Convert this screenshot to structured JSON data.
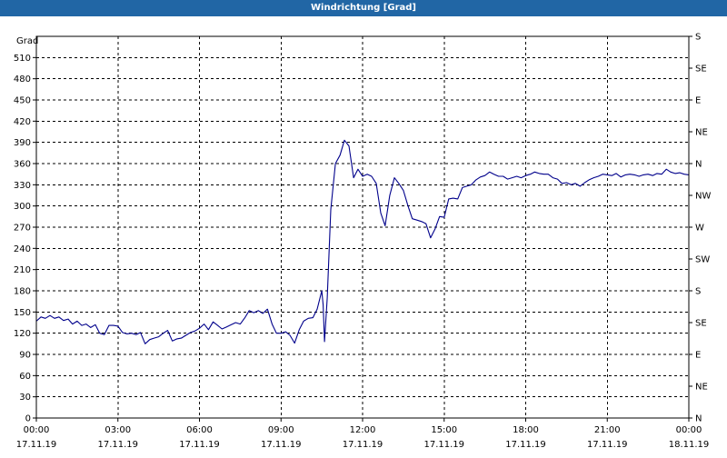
{
  "window": {
    "title": "Windrichtung [Grad]"
  },
  "chart_data": {
    "type": "line",
    "title": "Windrichtung [Grad]",
    "ylabel": "Grad",
    "xlabel": "",
    "ylim": [
      0,
      540
    ],
    "xlim_hours": [
      0,
      24
    ],
    "grid": true,
    "line_color": "#00008b",
    "y_ticks": [
      0,
      30,
      60,
      90,
      120,
      150,
      180,
      210,
      240,
      270,
      300,
      330,
      360,
      390,
      420,
      450,
      480,
      510
    ],
    "y_right_labels": [
      {
        "value": 0,
        "label": "N"
      },
      {
        "value": 45,
        "label": "NE"
      },
      {
        "value": 90,
        "label": "E"
      },
      {
        "value": 135,
        "label": "SE"
      },
      {
        "value": 180,
        "label": "S"
      },
      {
        "value": 225,
        "label": "SW"
      },
      {
        "value": 270,
        "label": "W"
      },
      {
        "value": 315,
        "label": "NW"
      },
      {
        "value": 360,
        "label": "N"
      },
      {
        "value": 405,
        "label": "NE"
      },
      {
        "value": 450,
        "label": "E"
      },
      {
        "value": 495,
        "label": "SE"
      },
      {
        "value": 540,
        "label": "S"
      }
    ],
    "x_ticks": [
      {
        "hour": 0,
        "time": "00:00",
        "date": "17.11.19"
      },
      {
        "hour": 3,
        "time": "03:00",
        "date": "17.11.19"
      },
      {
        "hour": 6,
        "time": "06:00",
        "date": "17.11.19"
      },
      {
        "hour": 9,
        "time": "09:00",
        "date": "17.11.19"
      },
      {
        "hour": 12,
        "time": "12:00",
        "date": "17.11.19"
      },
      {
        "hour": 15,
        "time": "15:00",
        "date": "17.11.19"
      },
      {
        "hour": 18,
        "time": "18:00",
        "date": "17.11.19"
      },
      {
        "hour": 21,
        "time": "21:00",
        "date": "17.11.19"
      },
      {
        "hour": 24,
        "time": "00:00",
        "date": "18.11.19"
      }
    ],
    "series": [
      {
        "points": [
          [
            0.0,
            137
          ],
          [
            0.17,
            143
          ],
          [
            0.33,
            141
          ],
          [
            0.5,
            145
          ],
          [
            0.67,
            141
          ],
          [
            0.83,
            143
          ],
          [
            1.0,
            138
          ],
          [
            1.17,
            140
          ],
          [
            1.33,
            133
          ],
          [
            1.5,
            137
          ],
          [
            1.67,
            131
          ],
          [
            1.83,
            133
          ],
          [
            2.0,
            128
          ],
          [
            2.17,
            132
          ],
          [
            2.33,
            120
          ],
          [
            2.5,
            118
          ],
          [
            2.67,
            131
          ],
          [
            2.83,
            131
          ],
          [
            3.0,
            130
          ],
          [
            3.17,
            121
          ],
          [
            3.33,
            119
          ],
          [
            3.5,
            120
          ],
          [
            3.67,
            118
          ],
          [
            3.83,
            121
          ],
          [
            4.0,
            105
          ],
          [
            4.17,
            111
          ],
          [
            4.33,
            113
          ],
          [
            4.5,
            115
          ],
          [
            4.67,
            120
          ],
          [
            4.83,
            124
          ],
          [
            5.0,
            109
          ],
          [
            5.17,
            112
          ],
          [
            5.33,
            113
          ],
          [
            5.5,
            117
          ],
          [
            5.67,
            121
          ],
          [
            5.83,
            123
          ],
          [
            6.0,
            127
          ],
          [
            6.17,
            133
          ],
          [
            6.33,
            125
          ],
          [
            6.5,
            136
          ],
          [
            6.67,
            131
          ],
          [
            6.83,
            126
          ],
          [
            7.0,
            129
          ],
          [
            7.17,
            132
          ],
          [
            7.33,
            135
          ],
          [
            7.5,
            133
          ],
          [
            7.67,
            142
          ],
          [
            7.83,
            152
          ],
          [
            8.0,
            149
          ],
          [
            8.17,
            152
          ],
          [
            8.33,
            148
          ],
          [
            8.5,
            154
          ],
          [
            8.67,
            133
          ],
          [
            8.83,
            120
          ],
          [
            9.0,
            120
          ],
          [
            9.17,
            122
          ],
          [
            9.33,
            117
          ],
          [
            9.5,
            106
          ],
          [
            9.67,
            125
          ],
          [
            9.83,
            137
          ],
          [
            10.0,
            141
          ],
          [
            10.17,
            142
          ],
          [
            10.33,
            154
          ],
          [
            10.5,
            180
          ],
          [
            10.55,
            160
          ],
          [
            10.6,
            108
          ],
          [
            10.7,
            170
          ],
          [
            10.83,
            295
          ],
          [
            11.0,
            360
          ],
          [
            11.17,
            372
          ],
          [
            11.33,
            393
          ],
          [
            11.5,
            385
          ],
          [
            11.67,
            340
          ],
          [
            11.83,
            352
          ],
          [
            12.0,
            342
          ],
          [
            12.17,
            345
          ],
          [
            12.33,
            342
          ],
          [
            12.5,
            332
          ],
          [
            12.67,
            290
          ],
          [
            12.83,
            272
          ],
          [
            13.0,
            315
          ],
          [
            13.17,
            340
          ],
          [
            13.33,
            332
          ],
          [
            13.5,
            322
          ],
          [
            13.67,
            300
          ],
          [
            13.83,
            282
          ],
          [
            14.0,
            280
          ],
          [
            14.17,
            278
          ],
          [
            14.33,
            275
          ],
          [
            14.5,
            255
          ],
          [
            14.67,
            268
          ],
          [
            14.83,
            285
          ],
          [
            15.0,
            284
          ],
          [
            15.17,
            310
          ],
          [
            15.33,
            311
          ],
          [
            15.5,
            310
          ],
          [
            15.67,
            326
          ],
          [
            15.83,
            328
          ],
          [
            16.0,
            330
          ],
          [
            16.17,
            337
          ],
          [
            16.33,
            341
          ],
          [
            16.5,
            343
          ],
          [
            16.67,
            348
          ],
          [
            16.83,
            345
          ],
          [
            17.0,
            342
          ],
          [
            17.17,
            342
          ],
          [
            17.33,
            338
          ],
          [
            17.5,
            340
          ],
          [
            17.67,
            342
          ],
          [
            17.83,
            340
          ],
          [
            18.0,
            343
          ],
          [
            18.17,
            345
          ],
          [
            18.33,
            348
          ],
          [
            18.5,
            346
          ],
          [
            18.67,
            345
          ],
          [
            18.83,
            345
          ],
          [
            19.0,
            340
          ],
          [
            19.17,
            338
          ],
          [
            19.33,
            332
          ],
          [
            19.5,
            333
          ],
          [
            19.67,
            330
          ],
          [
            19.83,
            332
          ],
          [
            20.0,
            328
          ],
          [
            20.17,
            333
          ],
          [
            20.33,
            337
          ],
          [
            20.5,
            340
          ],
          [
            20.67,
            342
          ],
          [
            20.83,
            345
          ],
          [
            21.0,
            344
          ],
          [
            21.17,
            343
          ],
          [
            21.33,
            346
          ],
          [
            21.5,
            341
          ],
          [
            21.67,
            344
          ],
          [
            21.83,
            345
          ],
          [
            22.0,
            344
          ],
          [
            22.17,
            342
          ],
          [
            22.33,
            344
          ],
          [
            22.5,
            345
          ],
          [
            22.67,
            343
          ],
          [
            22.83,
            346
          ],
          [
            23.0,
            345
          ],
          [
            23.17,
            352
          ],
          [
            23.33,
            348
          ],
          [
            23.5,
            346
          ],
          [
            23.67,
            347
          ],
          [
            23.83,
            345
          ],
          [
            24.0,
            344
          ]
        ]
      }
    ]
  }
}
